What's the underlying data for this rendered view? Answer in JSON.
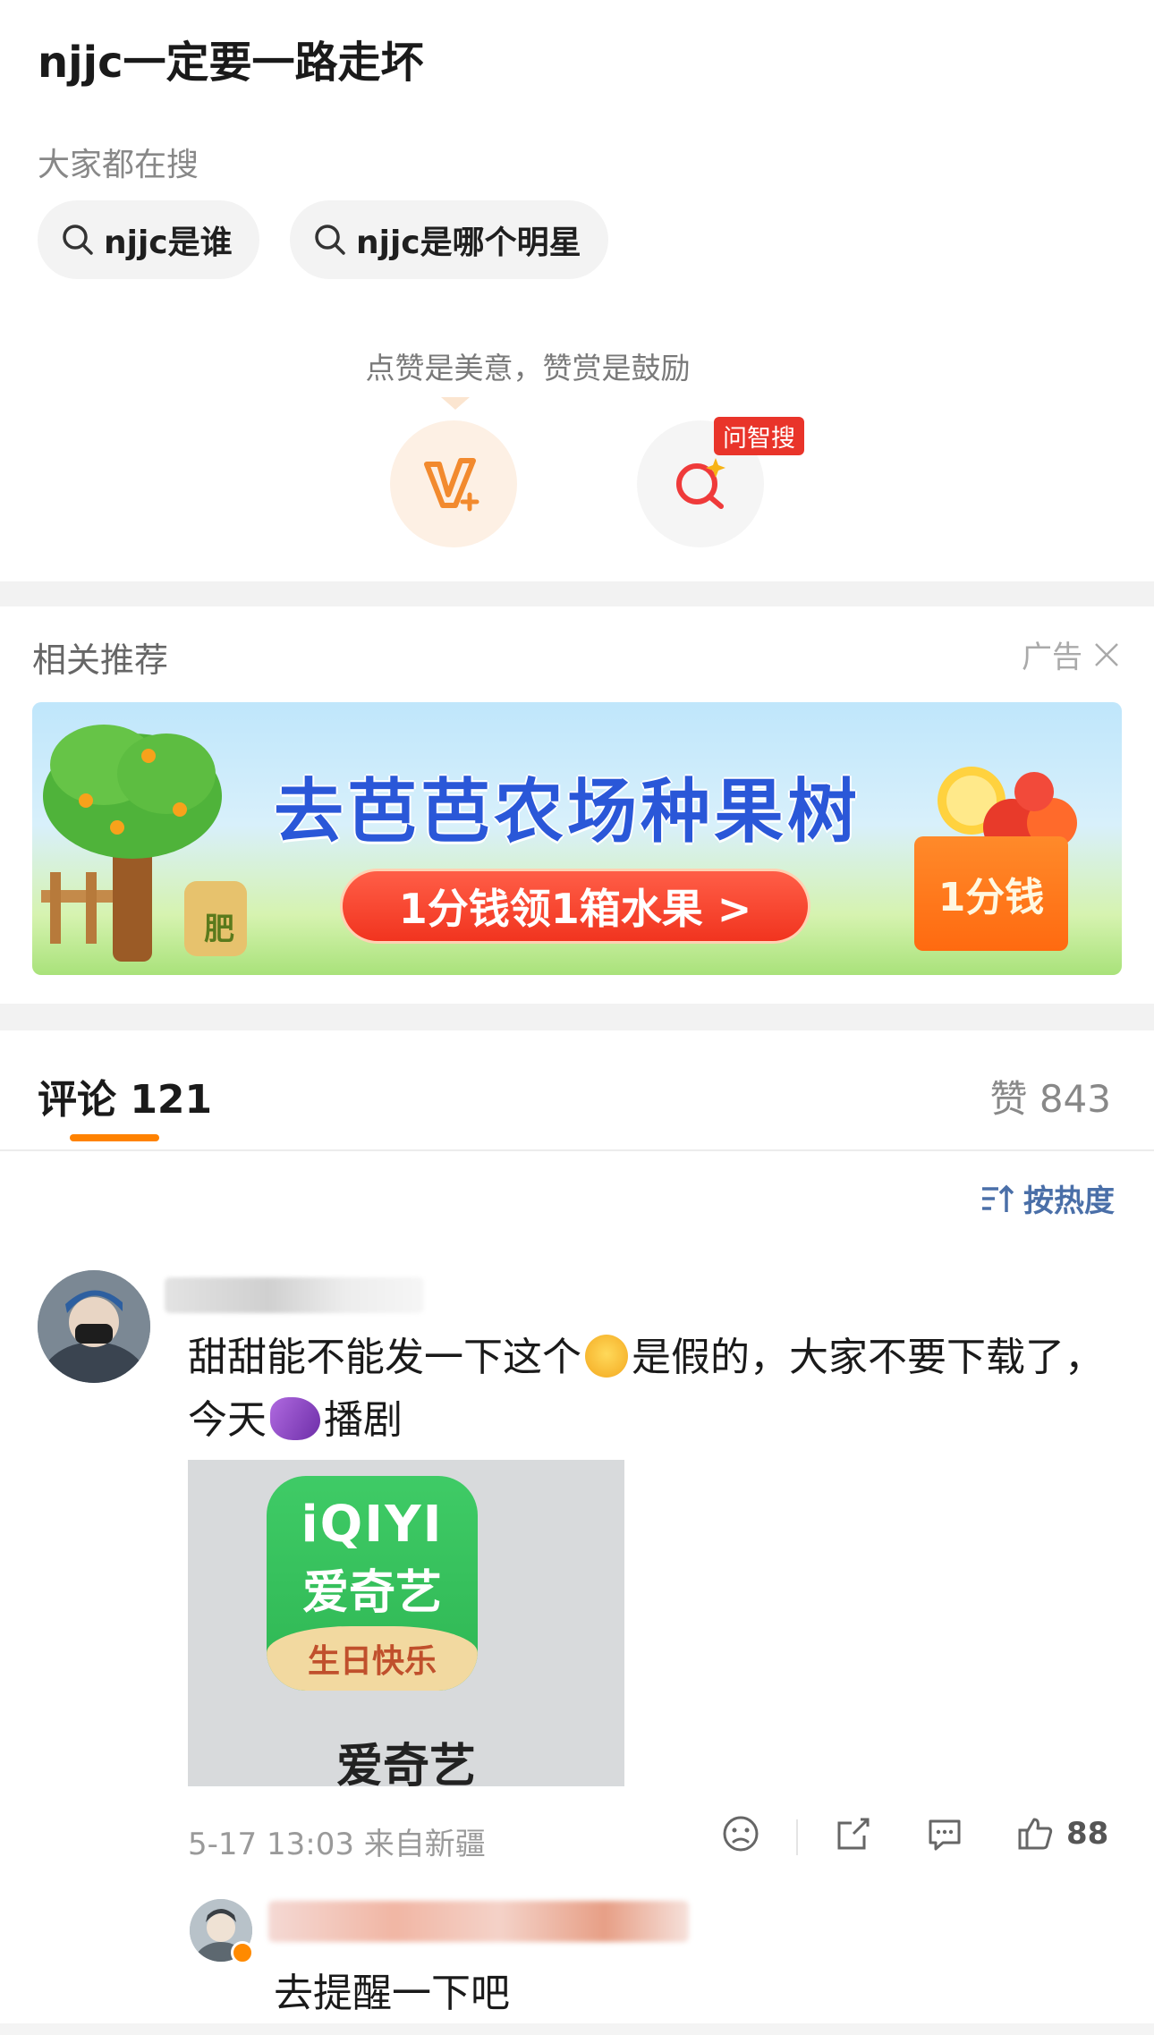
{
  "post": {
    "title": "njjc一定要一路走坏"
  },
  "search": {
    "label": "大家都在搜",
    "suggestions": [
      "njjc是谁",
      "njjc是哪个明星"
    ]
  },
  "praise": {
    "hint": "点赞是美意，赞赏是鼓励",
    "ask_badge": "问智搜"
  },
  "recommend": {
    "title": "相关推荐",
    "ad_label": "广告",
    "banner": {
      "headline": "去芭芭农场种果树",
      "cta": "1分钱领1箱水果 >",
      "box_label": "1分钱",
      "bag_label": "肥"
    }
  },
  "comments": {
    "tab_label": "评论 121",
    "likes_label": "赞 843",
    "sort_label": "按热度",
    "items": [
      {
        "text_part1": "甜甜能不能发一下这个",
        "text_part2": "是假的，大家不要下载了，今天",
        "text_part3": "播剧",
        "image": {
          "brand": "iQIYI",
          "name": "爱奇艺",
          "ribbon": "生日快乐",
          "caption": "爱奇艺"
        },
        "meta": "5-17 13:03 来自新疆",
        "like_count": "88",
        "reply": {
          "text": "去提醒一下吧"
        }
      }
    ]
  },
  "colors": {
    "accent": "#ff8200",
    "link_blue": "#4a6fa8",
    "badge_red": "#e9342a"
  },
  "icons": [
    "search-icon",
    "reward-v-icon",
    "ask-search-icon",
    "close-icon",
    "sort-icon",
    "dislike-face-icon",
    "share-icon",
    "comment-icon",
    "thumbs-up-icon"
  ]
}
